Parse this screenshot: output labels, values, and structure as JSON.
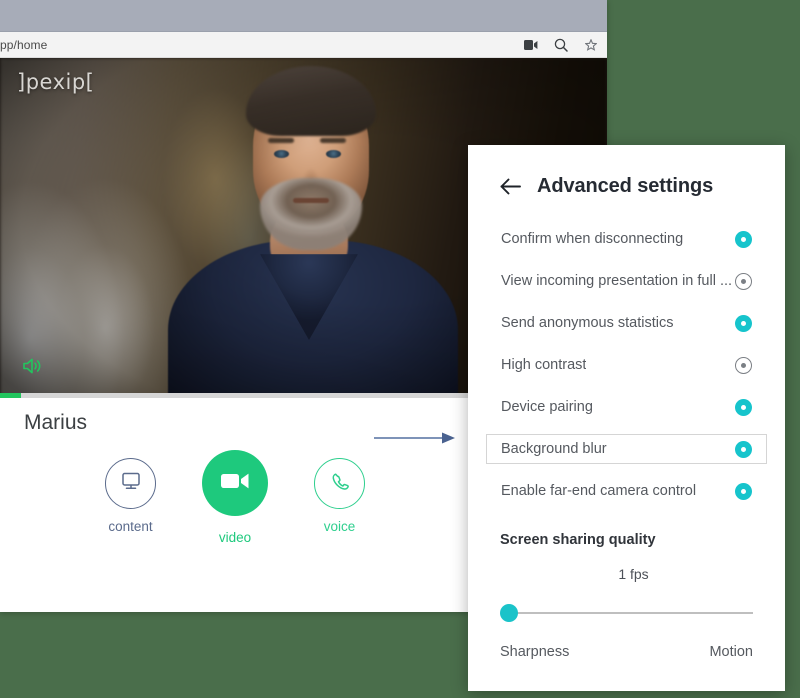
{
  "browser": {
    "url_text": "pp/home",
    "icons": [
      "camera-icon",
      "zoom-icon",
      "bookmark-star-icon"
    ]
  },
  "video_call": {
    "logo": "]pexip[",
    "participant_name": "Marius",
    "speaker_icon": "speaker-volume-icon",
    "controls": [
      {
        "label": "content",
        "icon": "monitor-screen-icon",
        "state": "inactive"
      },
      {
        "label": "video",
        "icon": "video-camera-icon",
        "state": "active"
      },
      {
        "label": "voice",
        "icon": "phone-handset-icon",
        "state": "inactive"
      }
    ],
    "swipe_arrow": "arrow-right-icon"
  },
  "settings": {
    "back_icon": "arrow-left-icon",
    "title": "Advanced settings",
    "rows": [
      {
        "label": "Confirm when disconnecting",
        "state": "on",
        "focused": false
      },
      {
        "label": "View incoming presentation in full ...",
        "state": "off",
        "focused": false
      },
      {
        "label": "Send anonymous statistics",
        "state": "on",
        "focused": false
      },
      {
        "label": "High contrast",
        "state": "off",
        "focused": false
      },
      {
        "label": "Device pairing",
        "state": "on",
        "focused": false
      },
      {
        "label": "Background blur",
        "state": "on",
        "focused": true
      },
      {
        "label": "Enable far-end camera control",
        "state": "on",
        "focused": false
      }
    ],
    "screen_sharing": {
      "section_title": "Screen sharing quality",
      "value": "1 fps",
      "slider_position_percent": 0,
      "min_label": "Sharpness",
      "max_label": "Motion"
    }
  },
  "colors": {
    "accent_teal": "#16c4cc",
    "accent_green": "#1ec97d",
    "page_background": "#4a6e4b",
    "title_bar": "#a7acb8"
  }
}
